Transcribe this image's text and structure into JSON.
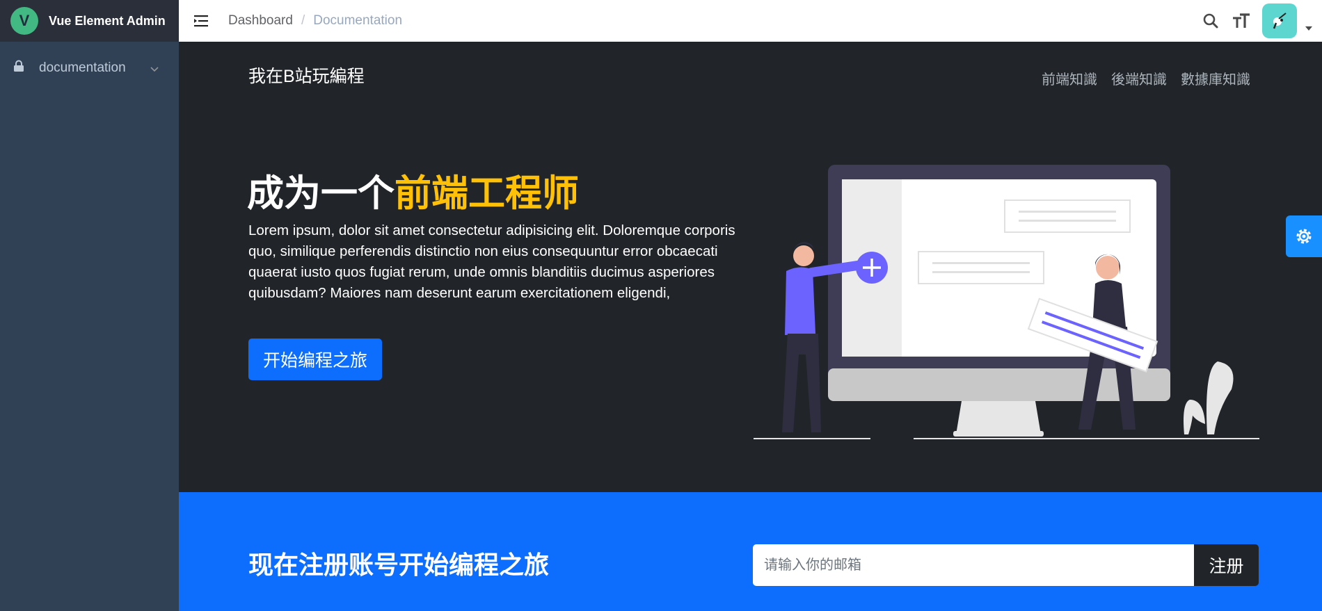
{
  "app": {
    "title": "Vue Element Admin",
    "logo_letter": "V"
  },
  "sidebar": {
    "items": [
      {
        "label": "documentation",
        "icon": "lock-icon"
      }
    ]
  },
  "header": {
    "breadcrumb": [
      "Dashboard",
      "Documentation"
    ],
    "separator": "/",
    "icons": [
      "search-icon",
      "font-size-icon",
      "avatar",
      "caret-down-icon"
    ]
  },
  "hero": {
    "brand": "我在B站玩編程",
    "links": [
      "前端知識",
      "後端知識",
      "數據庫知識"
    ],
    "title_prefix": "成为一个",
    "title_accent": "前端工程师",
    "description": "Lorem ipsum, dolor sit amet consectetur adipisicing elit. Doloremque corporis quo, similique perferendis distinctio non eius consequuntur error obcaecati quaerat iusto quos fugiat rerum, unde omnis blanditiis ducimus asperiores quibusdam? Maiores nam deserunt earum exercitationem eligendi,",
    "cta": "开始编程之旅"
  },
  "signup": {
    "title": "现在注册账号开始编程之旅",
    "email_placeholder": "请输入你的邮箱",
    "email_value": "",
    "button": "注册"
  },
  "colors": {
    "sidebar": "#304156",
    "logo_bg": "#2b2f3a",
    "hero_bg": "#212529",
    "accent": "#ffc107",
    "primary": "#0d6efd",
    "settings": "#1890ff"
  }
}
